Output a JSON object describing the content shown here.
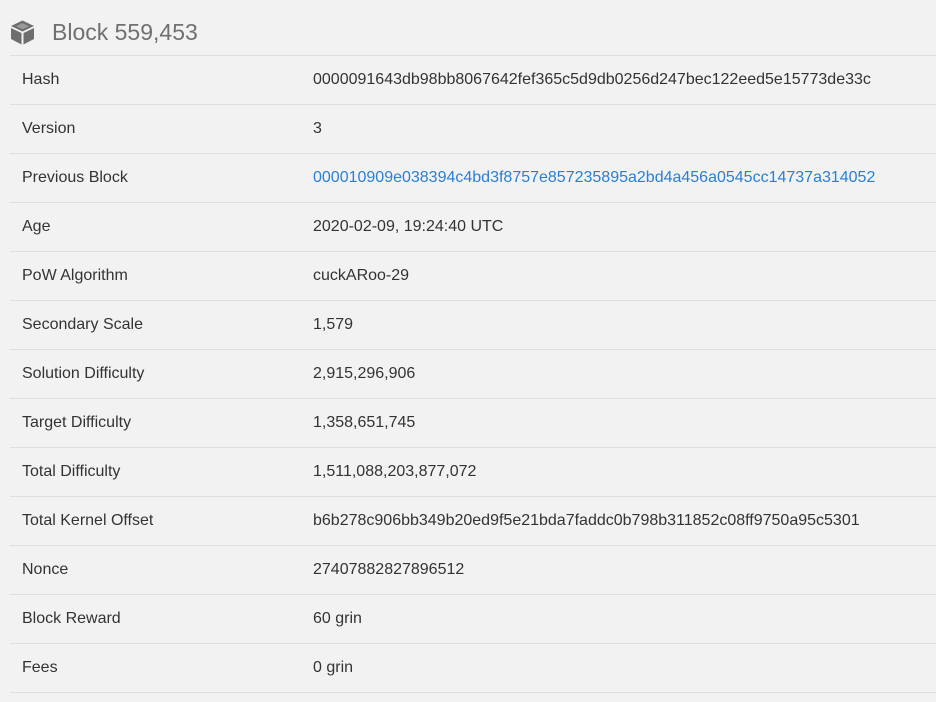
{
  "header": {
    "icon": "cube-icon",
    "title": "Block 559,453"
  },
  "colors": {
    "link": "#2a7fd4",
    "background": "#f2f2f2",
    "divider": "#dedede"
  },
  "rows": [
    {
      "label": "Hash",
      "value": "0000091643db98bb8067642fef365c5d9db0256d247bec122eed5e15773de33c"
    },
    {
      "label": "Version",
      "value": "3"
    },
    {
      "label": "Previous Block",
      "value": "000010909e038394c4bd3f8757e857235895a2bd4a456a0545cc14737a314052"
    },
    {
      "label": "Age",
      "value": "2020-02-09, 19:24:40 UTC"
    },
    {
      "label": "PoW Algorithm",
      "value": "cuckARoo-29"
    },
    {
      "label": "Secondary Scale",
      "value": "1,579"
    },
    {
      "label": "Solution Difficulty",
      "value": "2,915,296,906"
    },
    {
      "label": "Target Difficulty",
      "value": "1,358,651,745"
    },
    {
      "label": "Total Difficulty",
      "value": "1,511,088,203,877,072"
    },
    {
      "label": "Total Kernel Offset",
      "value": "b6b278c906bb349b20ed9f5e21bda7faddc0b798b311852c08ff9750a95c5301"
    },
    {
      "label": "Nonce",
      "value": "27407882827896512"
    },
    {
      "label": "Block Reward",
      "value": "60 grin"
    },
    {
      "label": "Fees",
      "value": "0 grin"
    }
  ]
}
